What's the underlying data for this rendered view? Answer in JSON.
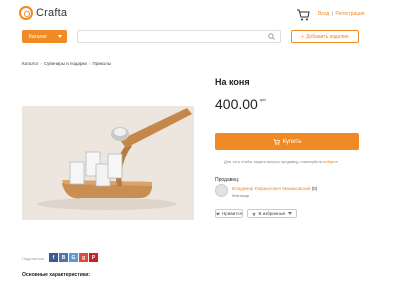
{
  "header": {
    "logo_text": "Crafta",
    "login_label": "Вход",
    "register_label": "Регистрация",
    "auth_separator": "|"
  },
  "search": {
    "catalog_label": "Каталог",
    "placeholder": "",
    "add_listing_label": "Добавить изделие"
  },
  "breadcrumb": {
    "items": [
      "Каталог",
      "Сувениры и подарки",
      "Приколы"
    ]
  },
  "product": {
    "title": "На коня",
    "price": "400.00",
    "currency": "грн",
    "buy_label": "Купить",
    "note_text": "Для того чтобы задать вопрос продавцу, пожалуйста",
    "note_link": "войдите"
  },
  "seller": {
    "label": "Продавец:",
    "name": "Владимир Рафаилович Мамиковский",
    "count": "(0)",
    "city": "Житомир"
  },
  "actions": {
    "like_label": "Нравится",
    "favorites_label": "В избранные"
  },
  "share": {
    "label": "Поделиться",
    "networks": [
      "f",
      "B",
      "G",
      "g",
      "P"
    ]
  },
  "specs": {
    "title": "Основные характеристики:"
  },
  "colors": {
    "accent": "#f08a24"
  }
}
